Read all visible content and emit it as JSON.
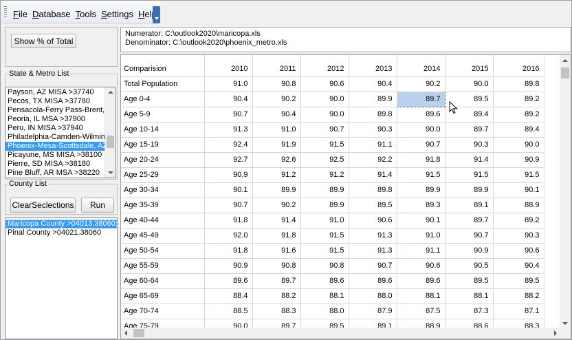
{
  "menu": {
    "items": [
      {
        "key": "F",
        "rest": "ile"
      },
      {
        "key": "D",
        "rest": "atabase"
      },
      {
        "key": "T",
        "rest": "ools"
      },
      {
        "key": "S",
        "rest": "ettings"
      },
      {
        "key": "H",
        "rest": "elp"
      }
    ]
  },
  "left": {
    "show_pct_button": "Show % of Total",
    "state_metro_label": "State & Metro List",
    "metro_items": [
      "Payson, AZ MISA >37740",
      "Pecos, TX MISA >37780",
      "Pensacola-Ferry Pass-Brent,",
      "Peoria, IL MSA >37900",
      "Peru, IN MISA >37940",
      "Philadelphia-Camden-Wilming",
      "Phoenix-Mesa-Scottsdale, AZ",
      "Picayune, MS MISA >38100",
      "Pierre, SD MISA >38180",
      "Pine Bluff, AR MSA >38220"
    ],
    "metro_selected_index": 6,
    "county_label": "County List",
    "clear_button": "ClearSeclections",
    "run_button": "Run",
    "county_items": [
      "Maricopa County >04013.38060",
      "Pinal County >04021.38060"
    ],
    "county_selected_index": 0
  },
  "header": {
    "numerator": "Numerator: C:\\outlook2020\\maricopa.xls",
    "denominator": "Denominator: C:\\outlook2020\\phoenix_metro.xls"
  },
  "grid": {
    "columns": [
      "Comparision",
      "2010",
      "2011",
      "2012",
      "2013",
      "2014",
      "2015",
      "2016"
    ],
    "rows": [
      [
        "Total Population",
        "91.0",
        "90.8",
        "90.6",
        "90.4",
        "90.2",
        "90.0",
        "89.8"
      ],
      [
        "Age 0-4",
        "90.4",
        "90.2",
        "90.0",
        "89.9",
        "89.7",
        "89.5",
        "89.2"
      ],
      [
        "Age 5-9",
        "90.7",
        "90.4",
        "90.0",
        "89.8",
        "89.6",
        "89.4",
        "89.2"
      ],
      [
        "Age 10-14",
        "91.3",
        "91.0",
        "90.7",
        "90.3",
        "90.0",
        "89.7",
        "89.4"
      ],
      [
        "Age 15-19",
        "92.4",
        "91.9",
        "91.5",
        "91.1",
        "90.7",
        "90.3",
        "90.0"
      ],
      [
        "Age 20-24",
        "92.7",
        "92.6",
        "92.5",
        "92.2",
        "91.8",
        "91.4",
        "90.9"
      ],
      [
        "Age 25-29",
        "90.9",
        "91.2",
        "91.2",
        "91.4",
        "91.5",
        "91.5",
        "91.5"
      ],
      [
        "Age 30-34",
        "90.1",
        "89.9",
        "89.9",
        "89.8",
        "89.9",
        "89.9",
        "90.1"
      ],
      [
        "Age 35-39",
        "90.7",
        "90.2",
        "89.9",
        "89.5",
        "89.3",
        "89.1",
        "88.9"
      ],
      [
        "Age 40-44",
        "91.8",
        "91.4",
        "91.0",
        "90.6",
        "90.1",
        "89.7",
        "89.2"
      ],
      [
        "Age 45-49",
        "92.0",
        "91.8",
        "91.5",
        "91.3",
        "91.0",
        "90.7",
        "90.3"
      ],
      [
        "Age 50-54",
        "91.8",
        "91.6",
        "91.5",
        "91.3",
        "91.1",
        "90.9",
        "90.6"
      ],
      [
        "Age 55-59",
        "90.9",
        "90.8",
        "90.8",
        "90.7",
        "90.6",
        "90.5",
        "90.4"
      ],
      [
        "Age 60-64",
        "89.6",
        "89.7",
        "89.6",
        "89.6",
        "89.6",
        "89.5",
        "89.5"
      ],
      [
        "Age 65-69",
        "88.4",
        "88.2",
        "88.1",
        "88.0",
        "88.1",
        "88.1",
        "88.2"
      ],
      [
        "Age 70-74",
        "88.5",
        "88.3",
        "88.0",
        "87.9",
        "87.5",
        "87.3",
        "87.1"
      ],
      [
        "Age 75-79",
        "90.0",
        "89.7",
        "89.5",
        "89.1",
        "88.9",
        "88.6",
        "88.3"
      ]
    ],
    "selected_cell": {
      "row": 1,
      "col": 5
    }
  }
}
